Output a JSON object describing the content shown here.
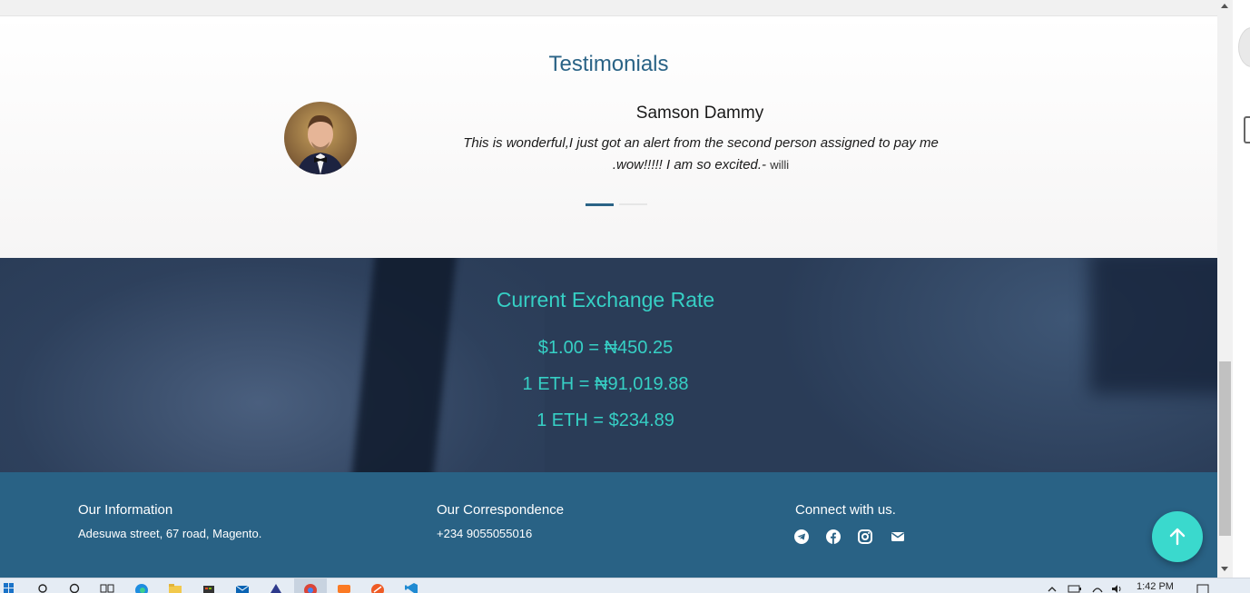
{
  "testimonials": {
    "title": "Testimonials",
    "name": "Samson Dammy",
    "quote": "This is wonderful,I just got an alert from the second person assigned to pay me .wow!!!!! I am so excited.-",
    "author": "willi"
  },
  "exchange": {
    "title": "Current Exchange Rate",
    "rates": [
      "$1.00 = ₦450.25",
      "1 ETH = ₦91,019.88",
      "1 ETH = $234.89"
    ]
  },
  "footer": {
    "info_title": "Our Information",
    "info_text": "Adesuwa street, 67 road, Magento.",
    "corr_title": "Our Correspondence",
    "corr_text": "+234 9055055016",
    "connect_title": "Connect with us.",
    "socials": [
      "telegram-icon",
      "facebook-icon",
      "instagram-icon",
      "mail-icon"
    ]
  },
  "taskbar": {
    "clock": "1:42 PM"
  },
  "colors": {
    "accent": "#36d0c5",
    "title_blue": "#2a6386",
    "footer_bg": "#296285",
    "exchange_bg": "#2a3c57",
    "fab": "#3ad9cd"
  }
}
